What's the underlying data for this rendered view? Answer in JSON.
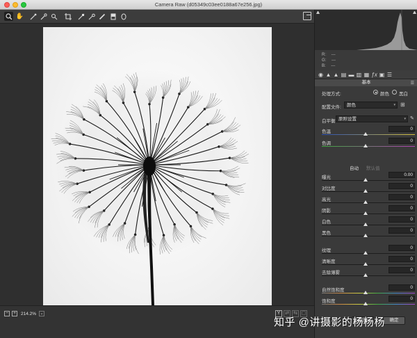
{
  "window": {
    "title": "Camera Raw (d05349c03ee0188a67e256.jpg)"
  },
  "toolbar": {
    "tools": [
      "zoom-icon",
      "hand-icon",
      "eyedropper-icon",
      "color-sampler-icon",
      "crop-icon",
      "straighten-icon",
      "spot-removal-icon",
      "redeye-icon",
      "brush-icon",
      "graduated-filter-icon",
      "radial-filter-icon"
    ]
  },
  "histogram": {
    "r": "R:",
    "g": "G:",
    "b": "B:",
    "r_val": "---",
    "g_val": "---",
    "b_val": "---"
  },
  "panel": {
    "section_title": "基本",
    "process_label": "处理方式:",
    "color_option": "颜色",
    "bw_option": "黑白",
    "profile_label": "配置文件:",
    "profile_value": "颜色",
    "wb_label": "白平衡:",
    "wb_value": "原照设置",
    "auto_label": "自动",
    "default_label": "默认值",
    "sliders": [
      {
        "label": "色温",
        "value": "0"
      },
      {
        "label": "色调",
        "value": "0"
      },
      {
        "label": "曝光",
        "value": "0.00"
      },
      {
        "label": "对比度",
        "value": "0"
      },
      {
        "label": "高光",
        "value": "0"
      },
      {
        "label": "阴影",
        "value": "0"
      },
      {
        "label": "白色",
        "value": "0"
      },
      {
        "label": "黑色",
        "value": "0"
      },
      {
        "label": "纹理",
        "value": "0"
      },
      {
        "label": "清晰度",
        "value": "0"
      },
      {
        "label": "去除薄雾",
        "value": "0"
      },
      {
        "label": "自然饱和度",
        "value": "0"
      },
      {
        "label": "饱和度",
        "value": "0"
      }
    ]
  },
  "bottombar": {
    "zoom_label": "214.2%"
  },
  "buttons": {
    "cancel": "取消",
    "ok": "确定"
  },
  "watermark": "知乎 @讲摄影的杨杨杨",
  "colors": {
    "panel_bg": "#3a3a3a",
    "canvas_bg": "#2f2f2f",
    "photo_bg": "#f4f4f4"
  }
}
